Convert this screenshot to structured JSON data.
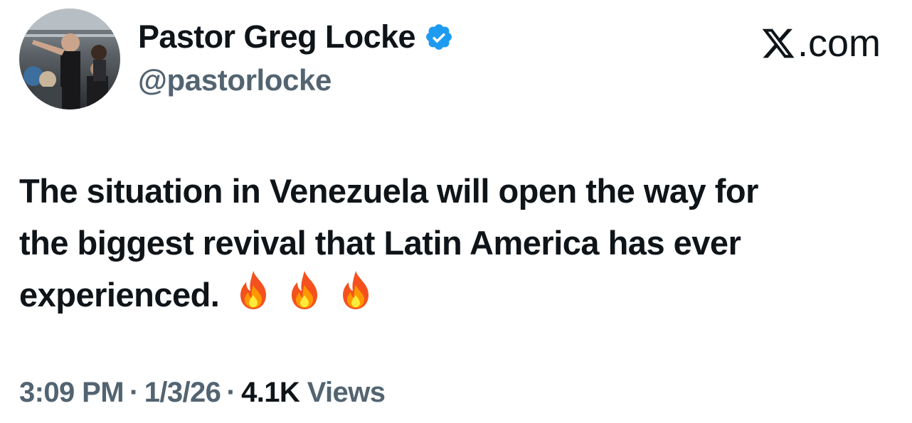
{
  "author": {
    "display_name": "Pastor Greg Locke",
    "handle": "@pastorlocke",
    "verified": true
  },
  "brand": {
    "text": ".com"
  },
  "tweet": {
    "lines": [
      "The situation in Venezuela will open the way for",
      "the biggest revival that Latin America has ever",
      "experienced."
    ],
    "emojis": [
      "fire",
      "fire",
      "fire"
    ]
  },
  "meta": {
    "time": "3:09 PM",
    "separator": "·",
    "date": "1/3/26",
    "views_count": "4.1K",
    "views_label": "Views"
  },
  "colors": {
    "text_primary": "#0f1419",
    "text_secondary": "#536471",
    "verified_blue": "#1d9bf0"
  }
}
